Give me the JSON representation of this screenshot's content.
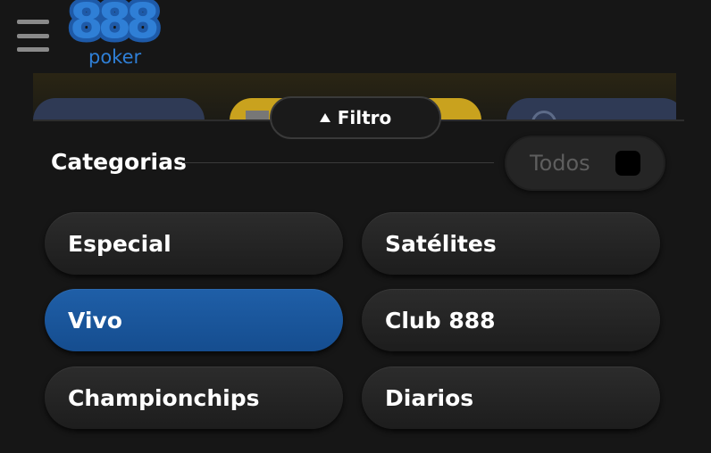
{
  "header": {
    "logo_digits": "888",
    "logo_word": "poker"
  },
  "filter": {
    "toggle_label": "Filtro"
  },
  "categories": {
    "title": "Categorias",
    "all_label": "Todos",
    "all_checked": false,
    "items": [
      {
        "label": "Especial",
        "active": false
      },
      {
        "label": "Satélites",
        "active": false
      },
      {
        "label": "Vivo",
        "active": true
      },
      {
        "label": "Club 888",
        "active": false
      },
      {
        "label": "Championchips",
        "active": false
      },
      {
        "label": "Diarios",
        "active": false
      }
    ]
  },
  "colors": {
    "background": "#161616",
    "accent": "#1f5fa8",
    "brand": "#2f7fd6",
    "button": "#262626"
  }
}
